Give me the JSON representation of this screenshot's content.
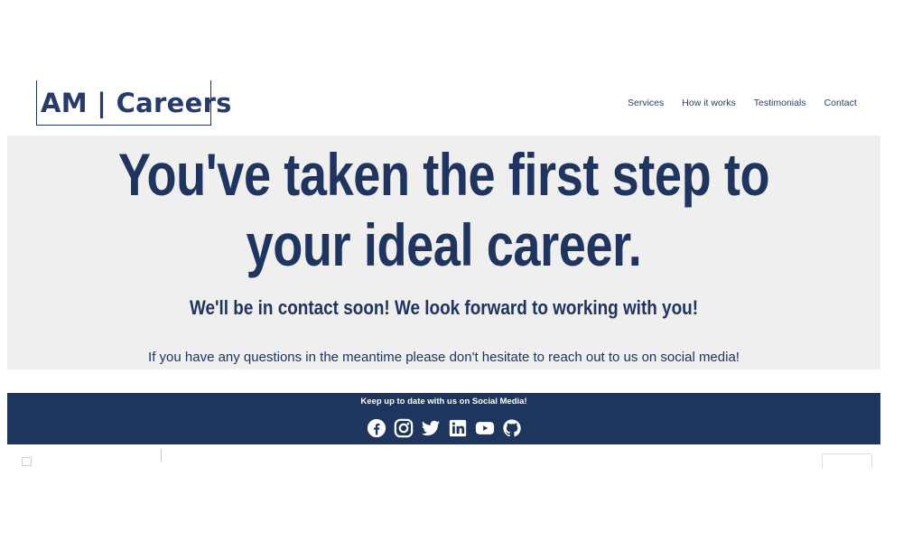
{
  "brand": {
    "logo_text": "AM | Careers"
  },
  "nav": {
    "items": [
      "Services",
      "How it works",
      "Testimonials",
      "Contact"
    ]
  },
  "hero": {
    "headline_line1": "You've taken the first step to",
    "headline_line2": "your ideal career.",
    "subheadline": "We'll be in contact soon! We look forward to working with you!",
    "body": "If you have any questions in the meantime please don't hesitate to reach out to us on social media!"
  },
  "footer": {
    "tagline": "Keep up to date with us on Social Media!",
    "social_icons": [
      "facebook-icon",
      "instagram-icon",
      "twitter-icon",
      "linkedin-icon",
      "youtube-icon",
      "github-icon"
    ]
  },
  "colors": {
    "navy": "#1e355e",
    "hero_bg": "#efefef",
    "text": "#1f3560"
  }
}
